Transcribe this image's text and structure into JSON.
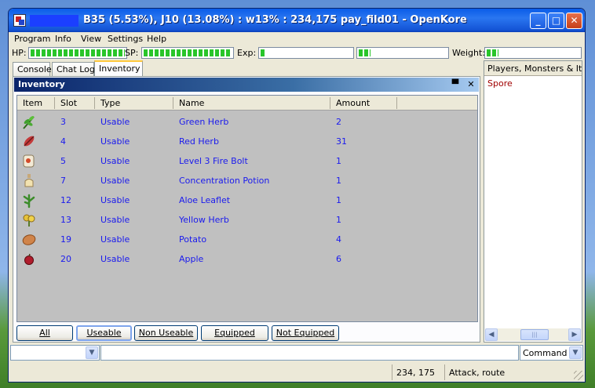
{
  "window": {
    "title": "B35 (5.53%), J10 (13.08%) : w13% : 234,175 pay_fild01 - OpenKore",
    "minimize": "_",
    "maximize": "□",
    "close": "✕"
  },
  "menu": [
    "Program",
    "Info",
    "View",
    "Settings",
    "Help"
  ],
  "stats": {
    "hp_label": "HP:",
    "hp_fill": 1.0,
    "sp_label": "SP:",
    "sp_fill": 1.0,
    "exp_label": "Exp:",
    "base_exp_fill": 0.0553,
    "job_exp_fill": 0.1308,
    "weight_label": "Weight:",
    "weight_fill": 0.13
  },
  "tabs": [
    "Console",
    "Chat Log",
    "Inventory"
  ],
  "inventory": {
    "title": "Inventory",
    "columns": [
      "Item",
      "Slot",
      "Type",
      "Name",
      "Amount"
    ],
    "rows": [
      {
        "icon": "green-herb-icon",
        "slot": "3",
        "type": "Usable",
        "name": "Green Herb",
        "amount": "2"
      },
      {
        "icon": "red-herb-icon",
        "slot": "4",
        "type": "Usable",
        "name": "Red Herb",
        "amount": "31"
      },
      {
        "icon": "fire-bolt-scroll-icon",
        "slot": "5",
        "type": "Usable",
        "name": "Level 3 Fire Bolt",
        "amount": "1"
      },
      {
        "icon": "potion-icon",
        "slot": "7",
        "type": "Usable",
        "name": "Concentration Potion",
        "amount": "1"
      },
      {
        "icon": "aloe-leaflet-icon",
        "slot": "12",
        "type": "Usable",
        "name": "Aloe Leaflet",
        "amount": "1"
      },
      {
        "icon": "yellow-herb-icon",
        "slot": "13",
        "type": "Usable",
        "name": "Yellow Herb",
        "amount": "1"
      },
      {
        "icon": "potato-icon",
        "slot": "19",
        "type": "Usable",
        "name": "Potato",
        "amount": "4"
      },
      {
        "icon": "apple-icon",
        "slot": "20",
        "type": "Usable",
        "name": "Apple",
        "amount": "6"
      }
    ],
    "filters": [
      "All",
      "Useable",
      "Non Useable",
      "Equipped",
      "Not Equipped"
    ],
    "selected_filter": "Useable"
  },
  "side_panel": {
    "header": "Players, Monsters & Items",
    "items": [
      "Spore"
    ]
  },
  "command": {
    "mode": "Command",
    "input_value": ""
  },
  "status": {
    "coords": "234, 175",
    "action": "Attack, route"
  },
  "colors": {
    "hp_bar": "#29c52a",
    "row_text": "#1a1aee",
    "monster_text": "#a00000"
  }
}
